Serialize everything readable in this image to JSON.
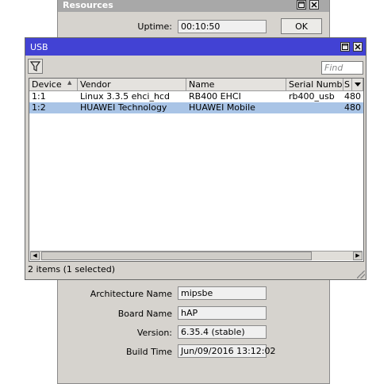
{
  "resources_window": {
    "title": "Resources",
    "uptime_label": "Uptime:",
    "uptime_value": "00:10:50",
    "ok_label": "OK",
    "architecture_label": "Architecture Name",
    "architecture_value": "mipsbe",
    "board_label": "Board Name",
    "board_value": "hAP",
    "version_label": "Version:",
    "version_value": "6.35.4 (stable)",
    "build_label": "Build Time",
    "build_value": "Jun/09/2016 13:12:02"
  },
  "usb_window": {
    "title": "USB",
    "find_placeholder": "Find",
    "columns": [
      "Device",
      "Vendor",
      "Name",
      "Serial Numbe",
      "S"
    ],
    "sort_arrow": "▲",
    "rows": [
      {
        "device": "1:1",
        "vendor": "Linux 3.3.5 ehci_hcd",
        "name": "RB400 EHCI",
        "serial": "rb400_usb",
        "speed": "480",
        "selected": false
      },
      {
        "device": "1:2",
        "vendor": "HUAWEI Technology",
        "name": "HUAWEI Mobile",
        "serial": "",
        "speed": "480",
        "selected": true
      }
    ],
    "status": "2 items (1 selected)"
  },
  "icons": {
    "filter": "filter-icon",
    "maximize": "maximize-icon",
    "close": "close-icon",
    "column_menu": "chevron-down-icon"
  },
  "colors": {
    "usb_titlebar": "#4242d4",
    "inactive_titlebar": "#a8a8a8",
    "selection": "#a9c4e6",
    "window_bg": "#d6d3ce"
  }
}
